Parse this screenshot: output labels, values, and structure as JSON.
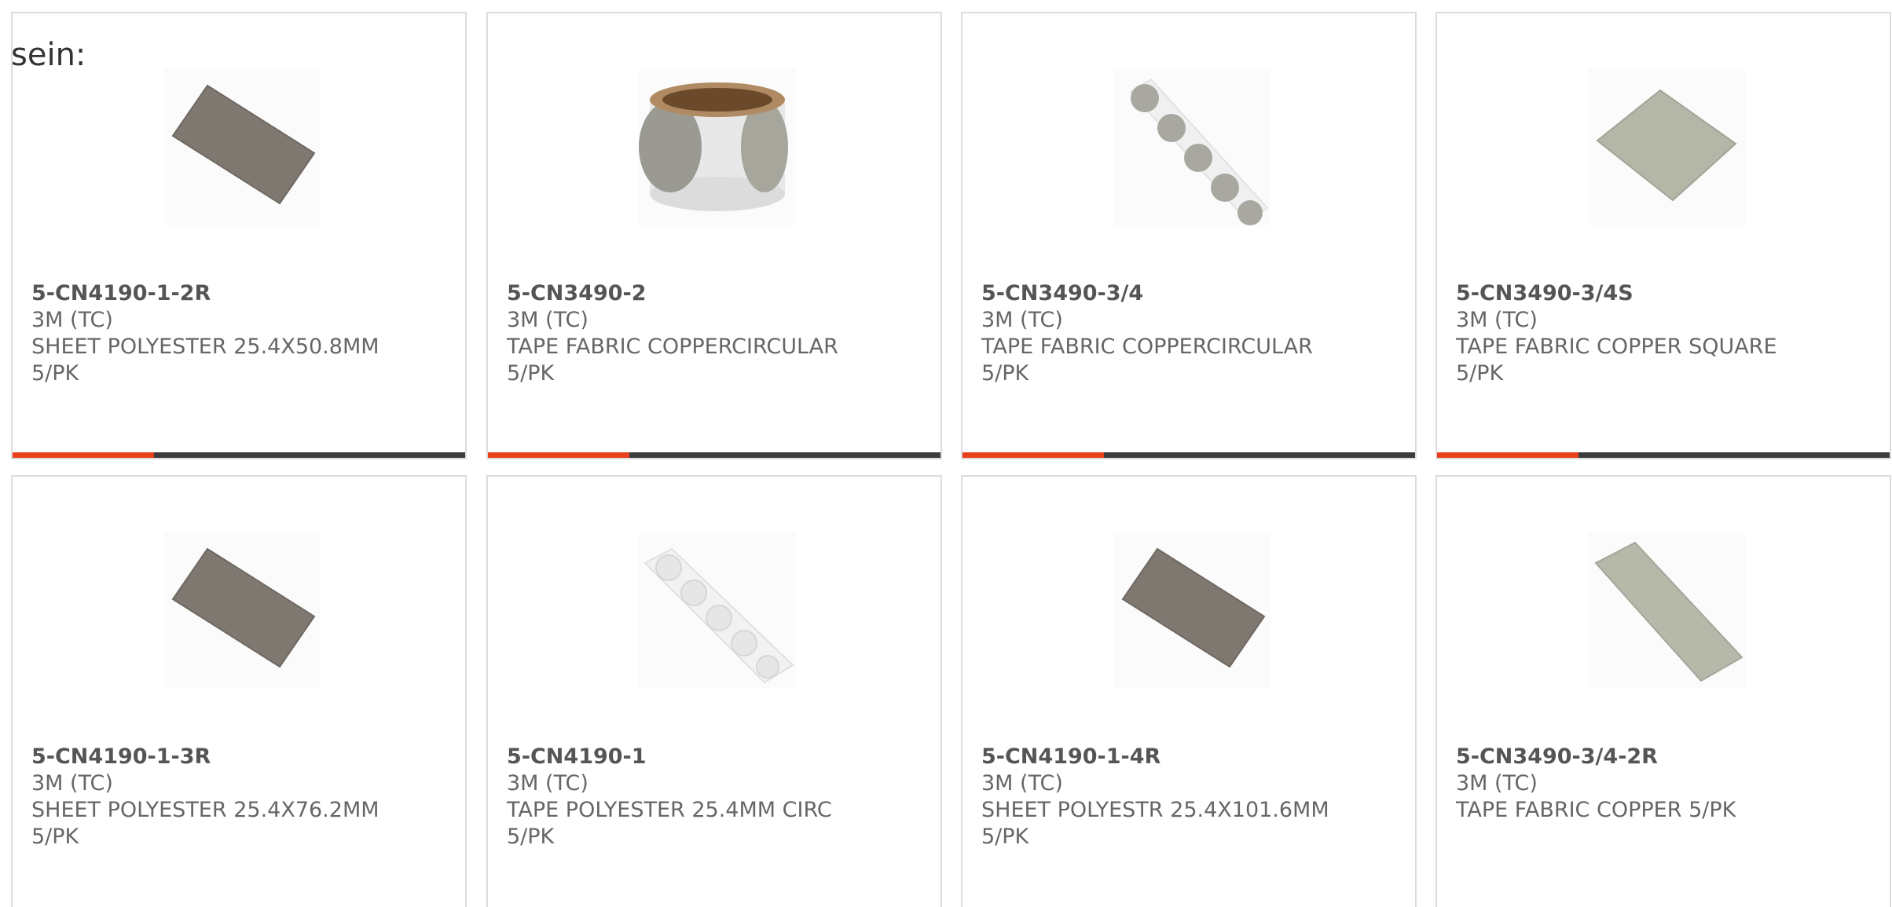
{
  "heading": "sein:",
  "colors": {
    "accent": "#e8401c",
    "bar": "#3c3c3c",
    "border": "#dcdcdc",
    "text": "#666666"
  },
  "products": [
    {
      "part": "5-CN4190-1-2R",
      "brand": "3M (TC)",
      "desc": "SHEET POLYESTER 25.4X50.8MM",
      "qty": "5/PK",
      "icon": "sheet-polyester-image"
    },
    {
      "part": "5-CN3490-2",
      "brand": "3M (TC)",
      "desc": "TAPE FABRIC COPPERCIRCULAR",
      "qty": "5/PK",
      "icon": "tape-roll-image"
    },
    {
      "part": "5-CN3490-3/4",
      "brand": "3M (TC)",
      "desc": "TAPE FABRIC COPPERCIRCULAR",
      "qty": "5/PK",
      "icon": "circular-dots-strip-image"
    },
    {
      "part": "5-CN3490-3/4S",
      "brand": "3M (TC)",
      "desc": "TAPE FABRIC COPPER SQUARE",
      "qty": "5/PK",
      "icon": "copper-square-image"
    },
    {
      "part": "5-CN4190-1-3R",
      "brand": "3M (TC)",
      "desc": "SHEET POLYESTER 25.4X76.2MM",
      "qty": "5/PK",
      "icon": "sheet-polyester-image"
    },
    {
      "part": "5-CN4190-1",
      "brand": "3M (TC)",
      "desc": "TAPE POLYESTER 25.4MM CIRC",
      "qty": "5/PK",
      "icon": "clear-dots-strip-image"
    },
    {
      "part": "5-CN4190-1-4R",
      "brand": "3M (TC)",
      "desc": "SHEET POLYESTR 25.4X101.6MM",
      "qty": "5/PK",
      "icon": "sheet-polyester-image"
    },
    {
      "part": "5-CN3490-3/4-2R",
      "brand": "3M (TC)",
      "desc": "TAPE FABRIC COPPER 5/PK",
      "icon": "copper-strip-image"
    }
  ]
}
